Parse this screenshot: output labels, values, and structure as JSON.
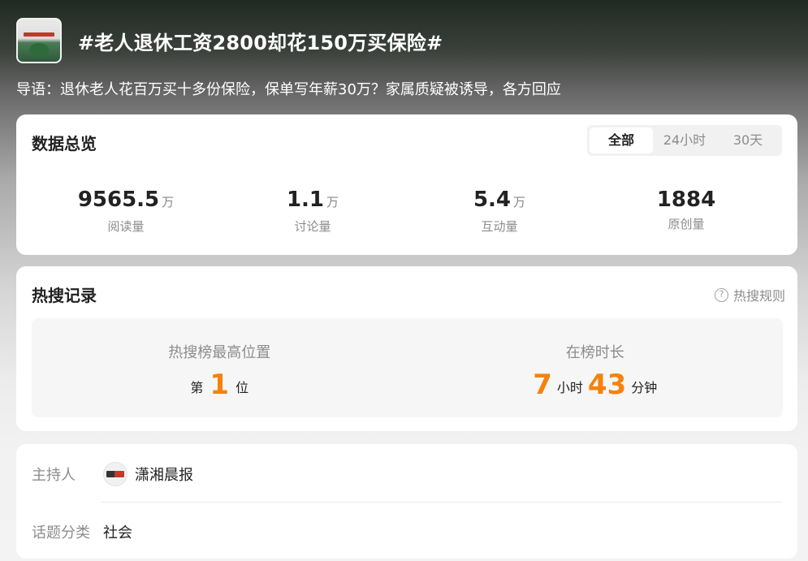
{
  "topic": {
    "title": "#老人退休工资2800却花150万买保险#",
    "intro": "导语：退休老人花百万买十多份保险，保单写年薪30万？家属质疑被诱导，各方回应"
  },
  "overview": {
    "title": "数据总览",
    "tabs": [
      "全部",
      "24小时",
      "30天"
    ],
    "active_tab": "全部",
    "stats": [
      {
        "value": "9565.5",
        "unit": "万",
        "label": "阅读量"
      },
      {
        "value": "1.1",
        "unit": "万",
        "label": "讨论量"
      },
      {
        "value": "5.4",
        "unit": "万",
        "label": "互动量"
      },
      {
        "value": "1884",
        "unit": "",
        "label": "原创量"
      }
    ]
  },
  "hot": {
    "title": "热搜记录",
    "rules_label": "热搜规则",
    "rules_icon": "question-circle-icon",
    "highest": {
      "label": "热搜榜最高位置",
      "prefix": "第",
      "value": "1",
      "suffix": "位"
    },
    "duration": {
      "label": "在榜时长",
      "hours": "7",
      "hours_unit": "小时",
      "minutes": "43",
      "minutes_unit": "分钟"
    }
  },
  "info": {
    "host_label": "主持人",
    "host_name": "潇湘晨报",
    "category_label": "话题分类",
    "category_value": "社会"
  },
  "colors": {
    "accent_orange": "#f5820d",
    "muted_text": "#8c8c8c"
  }
}
